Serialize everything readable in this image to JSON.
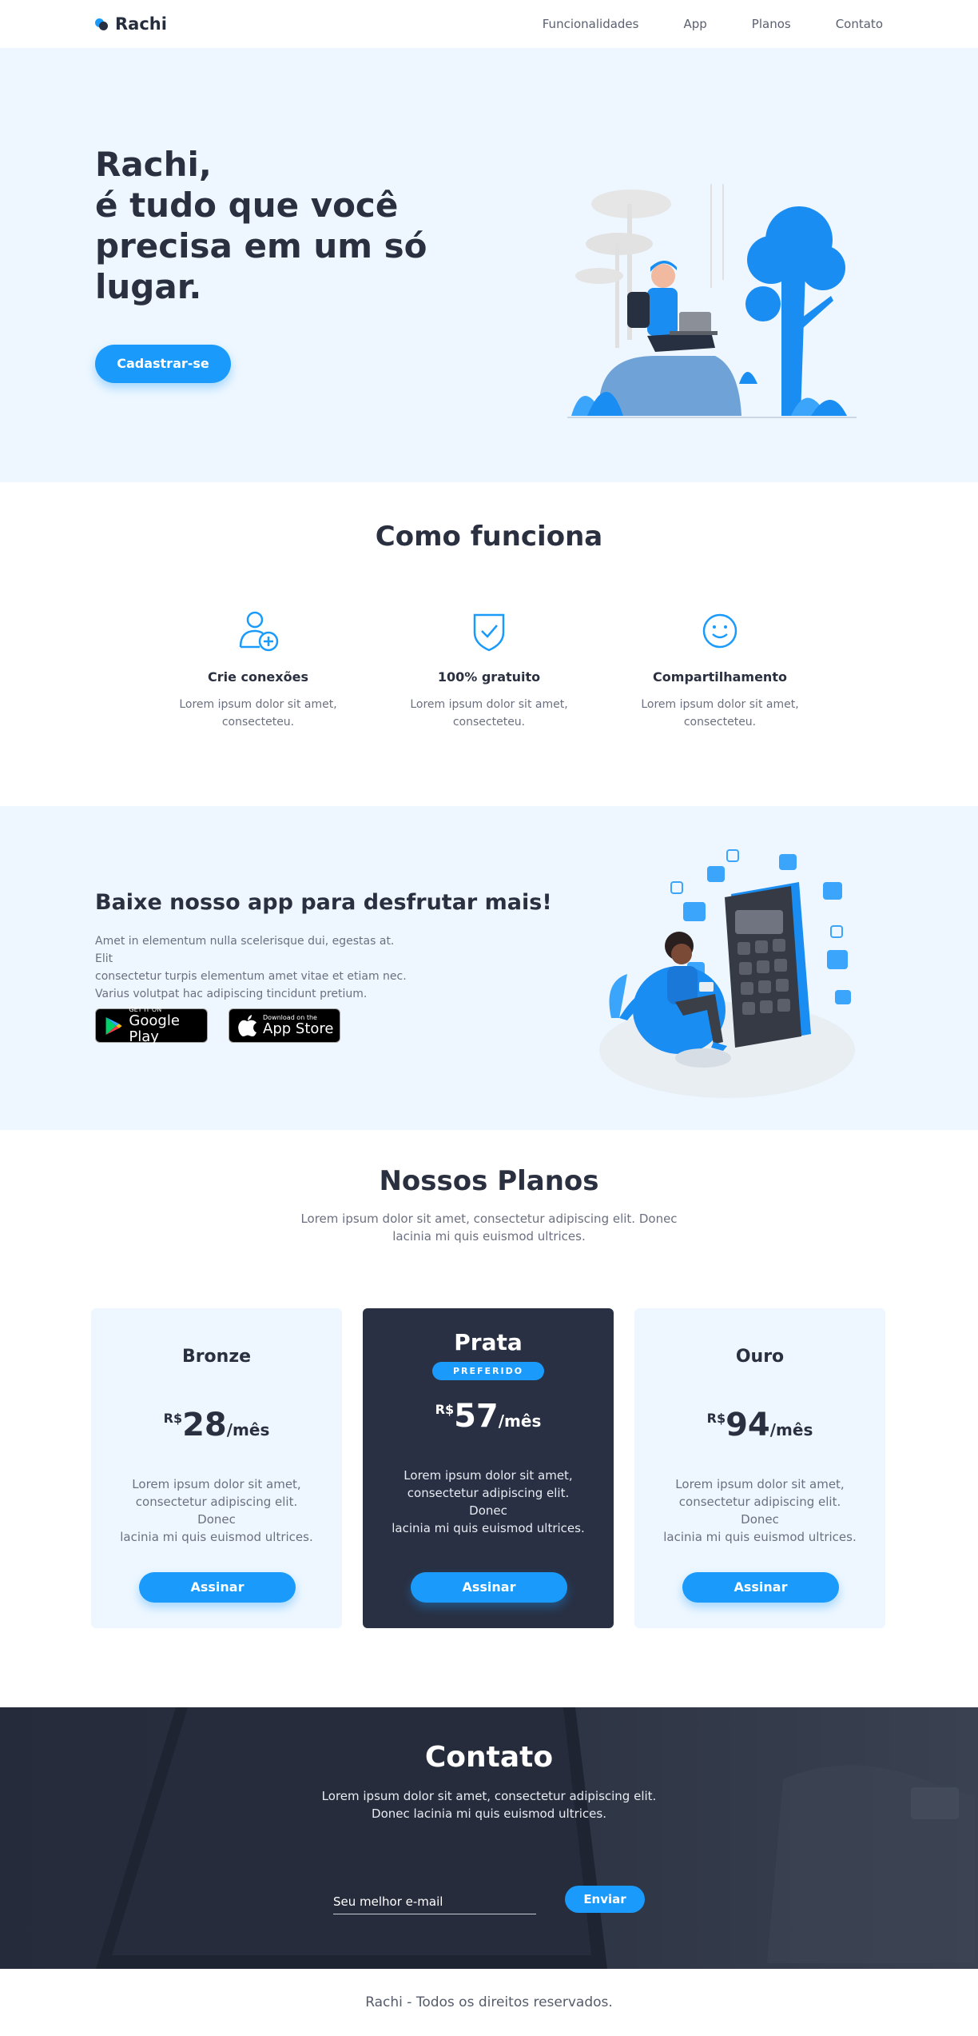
{
  "nav": {
    "brand": "Rachi",
    "links": [
      "Funcionalidades",
      "App",
      "Planos",
      "Contato"
    ]
  },
  "hero": {
    "headline": [
      "Rachi,",
      "é tudo que você",
      "precisa em um só",
      "lugar."
    ],
    "cta": "Cadastrar-se"
  },
  "how": {
    "title": "Como funciona",
    "features": [
      {
        "icon": "add-user-icon",
        "title": "Crie conexões",
        "text_lines": [
          "Lorem ipsum dolor sit amet,",
          "consecteteu."
        ]
      },
      {
        "icon": "shield-check-icon",
        "title": "100% gratuito",
        "text_lines": [
          "Lorem ipsum dolor sit amet,",
          "consecteteu."
        ]
      },
      {
        "icon": "smile-icon",
        "title": "Compartilhamento",
        "text_lines": [
          "Lorem ipsum dolor sit amet,",
          "consecteteu."
        ]
      }
    ]
  },
  "app": {
    "title": "Baixe nosso app para desfrutar mais!",
    "text_lines": [
      "Amet in elementum nulla scelerisque dui, egestas at. Elit",
      "consectetur turpis elementum amet vitae et etiam nec.",
      "Varius volutpat hac adipiscing tincidunt pretium."
    ],
    "google_small": "GET IT ON",
    "google_big": "Google Play",
    "apple_small": "Download on the",
    "apple_big": "App Store"
  },
  "plans": {
    "title": "Nossos Planos",
    "subtitle_lines": [
      "Lorem ipsum dolor sit amet, consectetur adipiscing elit. Donec",
      "lacinia mi quis euismod ultrices."
    ],
    "items": [
      {
        "name": "Bronze",
        "currency": "R$",
        "value": "28",
        "period": "/mês",
        "desc_lines": [
          "Lorem ipsum dolor sit amet,",
          "consectetur adipiscing elit. Donec",
          "lacinia mi quis euismod ultrices."
        ],
        "button": "Assinar"
      },
      {
        "name": "Prata",
        "badge": "PREFERIDO",
        "currency": "R$",
        "value": "57",
        "period": "/mês",
        "desc_lines": [
          "Lorem ipsum dolor sit amet,",
          "consectetur adipiscing elit. Donec",
          "lacinia mi quis euismod ultrices."
        ],
        "button": "Assinar"
      },
      {
        "name": "Ouro",
        "currency": "R$",
        "value": "94",
        "period": "/mês",
        "desc_lines": [
          "Lorem ipsum dolor sit amet,",
          "consectetur adipiscing elit. Donec",
          "lacinia mi quis euismod ultrices."
        ],
        "button": "Assinar"
      }
    ]
  },
  "contact": {
    "title": "Contato",
    "subtitle_lines": [
      "Lorem ipsum dolor sit amet, consectetur adipiscing elit.",
      "Donec lacinia mi quis euismod ultrices."
    ],
    "email_placeholder": "Seu melhor e-mail",
    "button": "Enviar"
  },
  "footer": {
    "text": "Rachi - Todos os direitos reservados."
  },
  "colors": {
    "accent": "#1a9bfc",
    "dark": "#293043",
    "light_bg": "#eef7ff"
  }
}
